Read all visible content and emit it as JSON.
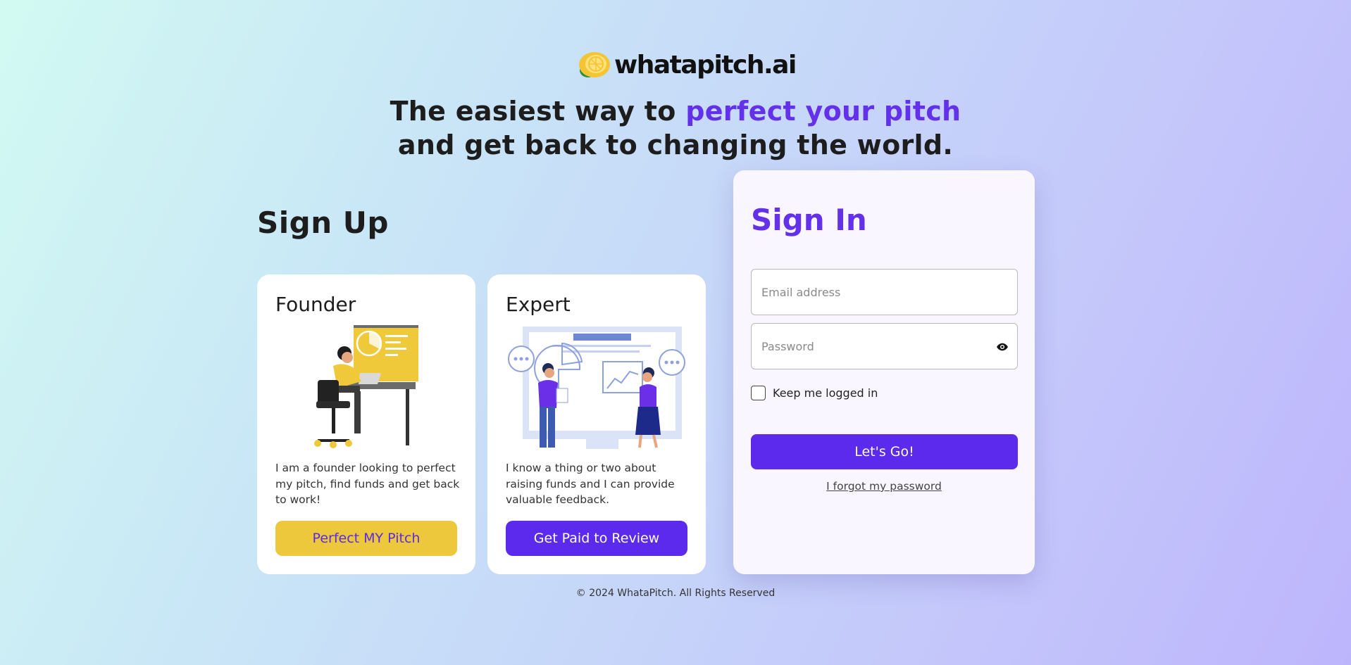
{
  "brand": {
    "name": "whatapitch.ai",
    "logo_icon": "lemon-icon",
    "colors": {
      "accent": "#6431ea",
      "button_purple": "#5c2aec",
      "button_yellow": "#edc73c"
    }
  },
  "headline": {
    "line1_prefix": "The easiest way to ",
    "line1_accent": "perfect your pitch",
    "line2": "and get back to changing the world."
  },
  "signup": {
    "title": "Sign Up",
    "cards": [
      {
        "title": "Founder",
        "illustration": "founder-at-desk-illustration",
        "description": "I am a founder looking to perfect my pitch, find funds and get back to work!",
        "button_label": "Perfect MY Pitch"
      },
      {
        "title": "Expert",
        "illustration": "experts-presenting-illustration",
        "description": "I know a thing or two about raising funds and I can provide valuable feedback.",
        "button_label": "Get Paid to Review"
      }
    ]
  },
  "signin": {
    "title": "Sign In",
    "email": {
      "placeholder": "Email address",
      "value": ""
    },
    "password": {
      "placeholder": "Password",
      "value": "",
      "toggle_icon": "eye-icon"
    },
    "keep_logged_in": {
      "label": "Keep me logged in",
      "checked": false
    },
    "submit_label": "Let's Go!",
    "forgot_label": "I forgot my password"
  },
  "footer": {
    "text": "© 2024 WhataPitch. All Rights Reserved"
  }
}
